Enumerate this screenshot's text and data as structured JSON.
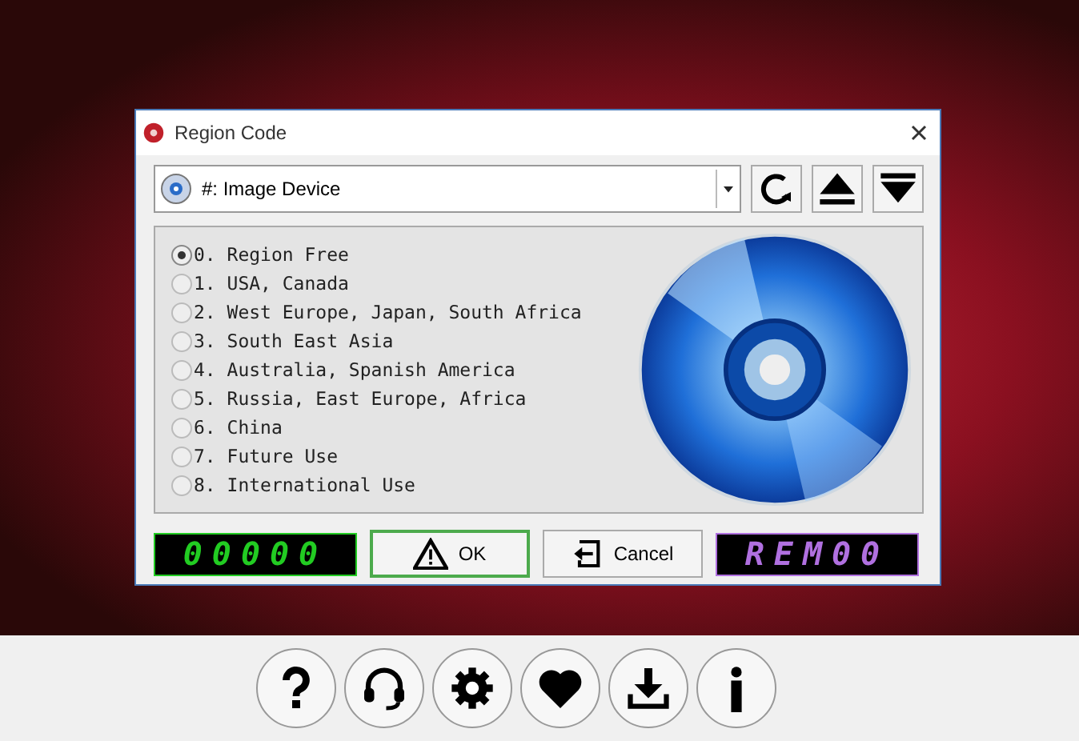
{
  "window": {
    "title": "Region Code"
  },
  "device": {
    "value": "#: Image Device"
  },
  "regions": [
    {
      "label": "0. Region Free",
      "selected": true
    },
    {
      "label": "1. USA, Canada",
      "selected": false
    },
    {
      "label": "2. West Europe, Japan, South Africa",
      "selected": false
    },
    {
      "label": "3. South East Asia",
      "selected": false
    },
    {
      "label": "4. Australia, Spanish America",
      "selected": false
    },
    {
      "label": "5. Russia, East Europe, Africa",
      "selected": false
    },
    {
      "label": "6. China",
      "selected": false
    },
    {
      "label": "7. Future Use",
      "selected": false
    },
    {
      "label": "8. International Use",
      "selected": false
    }
  ],
  "displays": [
    {
      "text": "00000",
      "color": "#22cc22"
    },
    {
      "text": "REM00",
      "color": "#b070e0"
    }
  ],
  "buttons": [
    {
      "label": "OK",
      "kind": "ok",
      "selected": true
    },
    {
      "label": "Cancel",
      "kind": "cancel",
      "selected": false
    }
  ],
  "toolbar": [
    {
      "kind": "help"
    },
    {
      "kind": "support"
    },
    {
      "kind": "settings"
    },
    {
      "kind": "favorite"
    },
    {
      "kind": "download"
    },
    {
      "kind": "info"
    }
  ]
}
